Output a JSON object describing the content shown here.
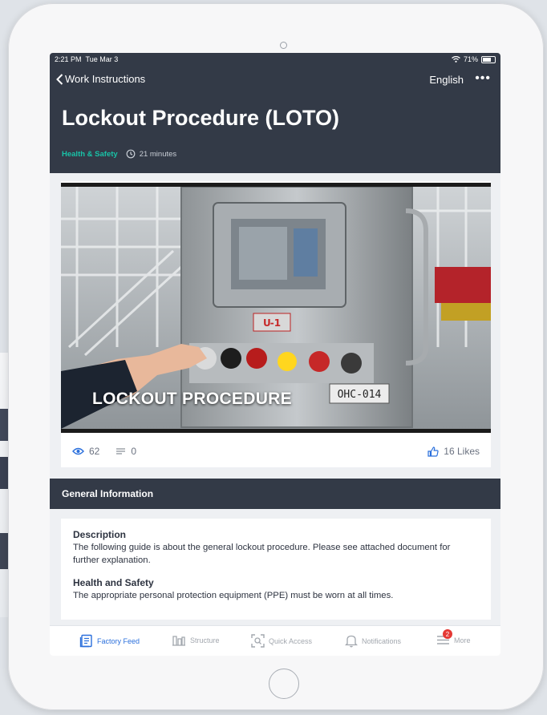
{
  "status_bar": {
    "time": "2:21 PM",
    "date": "Tue Mar 3",
    "battery": "71%"
  },
  "nav": {
    "back_label": "Work Instructions",
    "language": "English",
    "more_label": "•••"
  },
  "instruction": {
    "title": "Lockout Procedure (LOTO)",
    "category": "Health & Safety",
    "duration": "21 minutes"
  },
  "video": {
    "caption": "LOCKOUT PROCEDURE",
    "machine_tag": "OHC-014",
    "panel_label": "Ս-1"
  },
  "stats": {
    "views": "62",
    "comments": "0",
    "likes": "16 Likes"
  },
  "general_info": {
    "section_title": "General Information",
    "description_heading": "Description",
    "description_text": "The following guide is about the general lockout procedure. Please see attached document for further explanation.",
    "safety_heading": "Health and Safety",
    "safety_text": "The appropriate personal protection equipment (PPE) must be worn at all times."
  },
  "tabs": [
    {
      "label": "Factory Feed",
      "icon": "feed-icon",
      "active": true
    },
    {
      "label": "Structure",
      "icon": "structure-icon",
      "active": false
    },
    {
      "label": "Quick Access",
      "icon": "scan-icon",
      "active": false
    },
    {
      "label": "Notifications",
      "icon": "bell-icon",
      "active": false
    },
    {
      "label": "More",
      "icon": "menu-icon",
      "active": false,
      "badge": "2"
    }
  ],
  "colors": {
    "header_bg": "#333a47",
    "accent": "#19c2a7",
    "active_tab": "#2a6fdc",
    "badge": "#e53935"
  }
}
